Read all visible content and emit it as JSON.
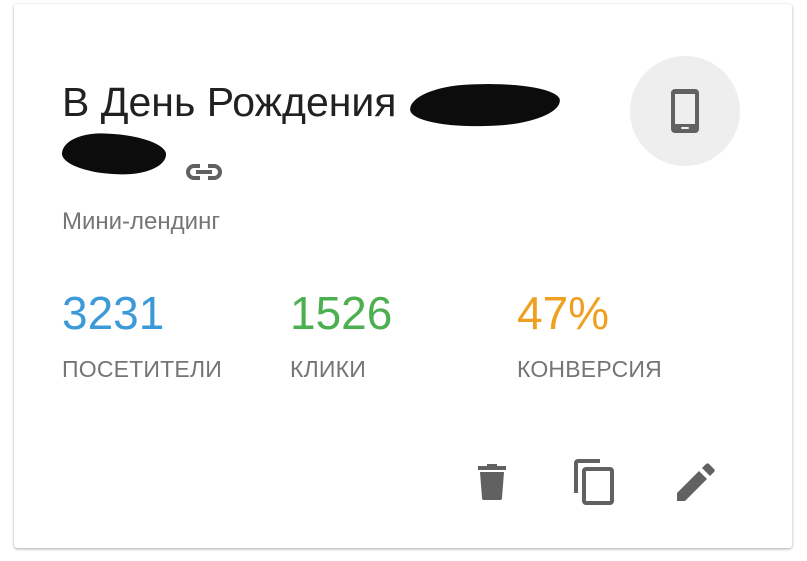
{
  "card": {
    "title_text": "В День Рождения",
    "subtitle": "Мини-лендинг",
    "device_icon": "smartphone-icon",
    "link_icon": "link-icon"
  },
  "stats": {
    "visitors": {
      "value": "3231",
      "label": "ПОСЕТИТЕЛИ",
      "color": "#3d9ad8"
    },
    "clicks": {
      "value": "1526",
      "label": "КЛИКИ",
      "color": "#4caf50"
    },
    "conversion": {
      "value": "47%",
      "label": "КОНВЕРСИЯ",
      "color": "#f0a020"
    }
  },
  "actions": {
    "delete_icon": "delete-icon",
    "copy_icon": "copy-icon",
    "edit_icon": "edit-icon"
  },
  "colors": {
    "icon_gray": "#616161",
    "text_primary": "#212121",
    "text_secondary": "#757575"
  }
}
